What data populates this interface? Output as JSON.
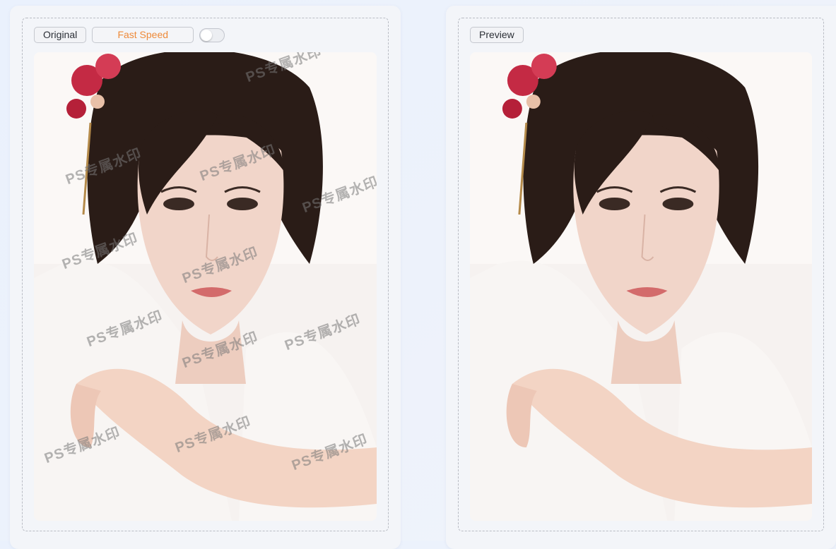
{
  "original_panel": {
    "original_label": "Original",
    "speed_label": "Fast Speed",
    "toggle_on": false,
    "watermark_text": "PS专属水印",
    "watermark_count": 12
  },
  "preview_panel": {
    "preview_label": "Preview"
  },
  "colors": {
    "accent": "#ee8a39",
    "hair": "#2a1c17",
    "skin": "#f1d5c9",
    "flower": "#c42a44",
    "garment": "#f6f2f0"
  }
}
